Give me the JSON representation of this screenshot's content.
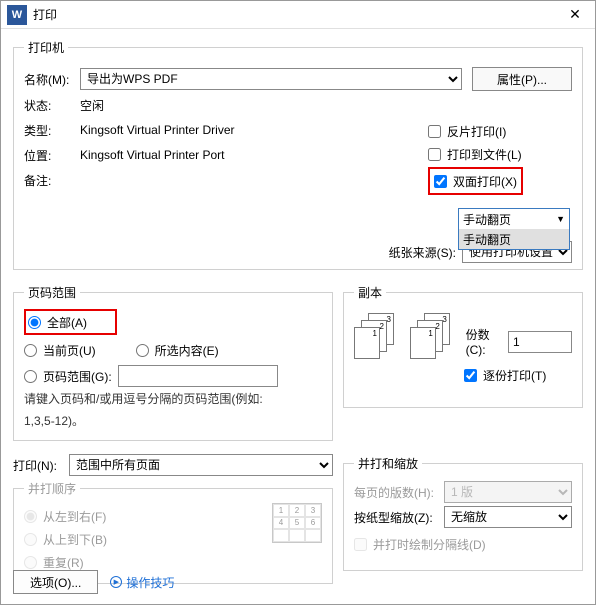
{
  "window": {
    "title": "打印",
    "icon_letter": "W"
  },
  "printer": {
    "legend": "打印机",
    "name_label": "名称(M):",
    "name_value": "导出为WPS PDF",
    "properties_btn": "属性(P)...",
    "status_label": "状态:",
    "status_value": "空闲",
    "type_label": "类型:",
    "type_value": "Kingsoft Virtual Printer Driver",
    "location_label": "位置:",
    "location_value": "Kingsoft Virtual Printer Port",
    "comment_label": "备注:",
    "reverse_label": "反片打印(I)",
    "tofile_label": "打印到文件(L)",
    "duplex_label": "双面打印(X)",
    "duplex_selected": "手动翻页",
    "duplex_option": "手动翻页",
    "paper_src_label": "纸张来源(S):",
    "paper_src_value": "使用打印机设置"
  },
  "range": {
    "legend": "页码范围",
    "all": "全部(A)",
    "current": "当前页(U)",
    "selection": "所选内容(E)",
    "pages": "页码范围(G):",
    "hint1": "请键入页码和/或用逗号分隔的页码范围(例如:",
    "hint2": "1,3,5-12)。",
    "print_label": "打印(N):",
    "print_value": "范围中所有页面"
  },
  "copies": {
    "legend": "副本",
    "count_label": "份数(C):",
    "count_value": "1",
    "collate": "逐份打印(T)"
  },
  "order": {
    "legend": "并打顺序",
    "lr": "从左到右(F)",
    "tb": "从上到下(B)",
    "repeat": "重复(R)"
  },
  "scale": {
    "legend": "并打和缩放",
    "perpage_label": "每页的版数(H):",
    "perpage_value": "1 版",
    "zoom_label": "按纸型缩放(Z):",
    "zoom_value": "无缩放",
    "divider": "并打时绘制分隔线(D)"
  },
  "footer": {
    "options_btn": "选项(O)...",
    "tips": "操作技巧"
  }
}
